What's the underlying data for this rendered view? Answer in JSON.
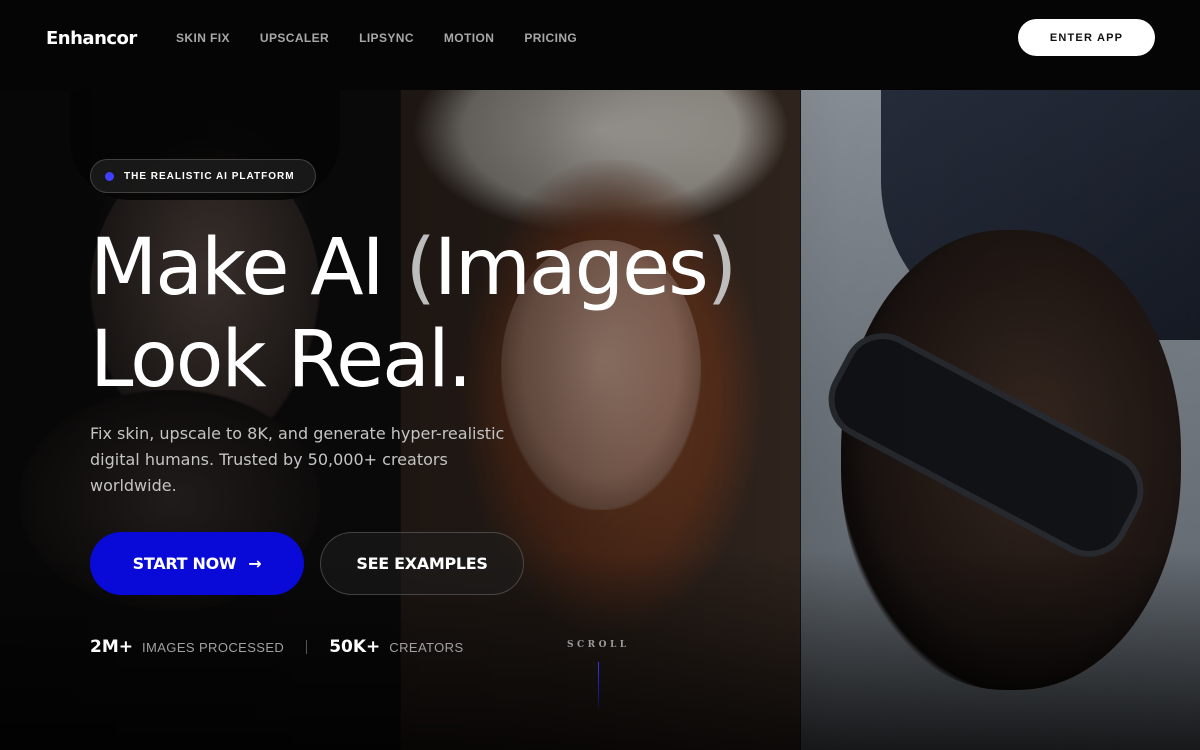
{
  "nav": {
    "logo": "Enhancor",
    "items": [
      "SKIN FIX",
      "UPSCALER",
      "LIPSYNC",
      "MOTION",
      "PRICING"
    ],
    "cta": "ENTER APP"
  },
  "hero": {
    "badge": "THE REALISTIC AI PLATFORM",
    "headline_part1": "Make AI ",
    "headline_paren_open": "(",
    "headline_word": "Images",
    "headline_paren_close": ")",
    "headline_line2": "Look Real.",
    "subtitle": "Fix skin, upscale to 8K, and generate hyper-realistic digital humans. Trusted by 50,000+ creators worldwide.",
    "primary_button": "START NOW",
    "primary_button_icon": "→",
    "secondary_button": "SEE EXAMPLES",
    "stats": [
      {
        "value": "2M+",
        "label": "IMAGES PROCESSED"
      },
      {
        "value": "50K+",
        "label": "CREATORS"
      }
    ],
    "scroll_label": "SCROLL"
  },
  "colors": {
    "accent": "#0a0ad8",
    "background": "#050505"
  }
}
